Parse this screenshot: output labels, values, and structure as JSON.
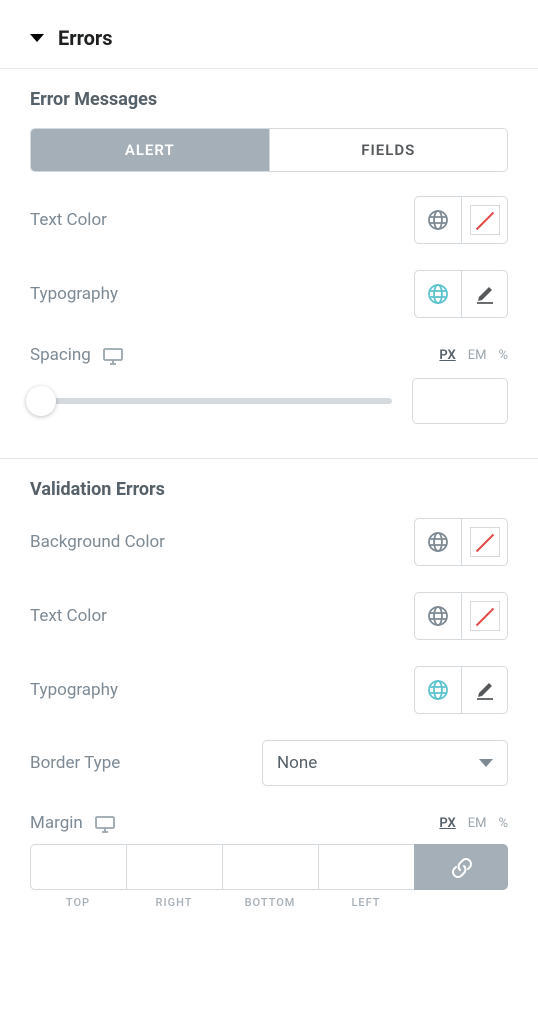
{
  "section": {
    "title": "Errors"
  },
  "error_messages": {
    "heading": "Error Messages",
    "tabs": [
      "ALERT",
      "FIELDS"
    ],
    "active_tab": 0,
    "text_color": {
      "label": "Text Color"
    },
    "typography": {
      "label": "Typography"
    },
    "spacing": {
      "label": "Spacing",
      "units": [
        "PX",
        "EM",
        "%"
      ],
      "active_unit": 0,
      "value": ""
    }
  },
  "validation_errors": {
    "heading": "Validation Errors",
    "background_color": {
      "label": "Background Color"
    },
    "text_color": {
      "label": "Text Color"
    },
    "typography": {
      "label": "Typography"
    },
    "border_type": {
      "label": "Border Type",
      "value": "None"
    },
    "margin": {
      "label": "Margin",
      "units": [
        "PX",
        "EM",
        "%"
      ],
      "active_unit": 0,
      "sides": [
        "TOP",
        "RIGHT",
        "BOTTOM",
        "LEFT"
      ],
      "values": [
        "",
        "",
        "",
        ""
      ]
    }
  }
}
